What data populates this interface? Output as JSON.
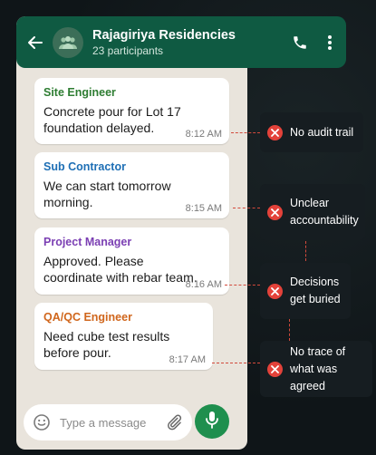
{
  "header": {
    "title": "Rajagiriya Residencies",
    "subtitle": "23 participants"
  },
  "messages": [
    {
      "sender": "Site Engineer",
      "sender_color": "#2e7d32",
      "text": "Concrete pour for Lot 17 foundation delayed.",
      "time": "8:12 AM"
    },
    {
      "sender": "Sub Contractor",
      "sender_color": "#1e6fb5",
      "text": "We can start tomorrow morning.",
      "time": "8:15 AM"
    },
    {
      "sender": "Project Manager",
      "sender_color": "#7b3fb3",
      "text": "Approved. Please coordinate with rebar team.",
      "time": "8:16 AM"
    },
    {
      "sender": "QA/QC Engineer",
      "sender_color": "#d0661c",
      "text": "Need cube test results before pour.",
      "time": "8:17 AM"
    }
  ],
  "input": {
    "placeholder": "Type a message"
  },
  "callouts": [
    {
      "text": "No audit trail"
    },
    {
      "text": "Unclear accountability"
    },
    {
      "text": "Decisions get buried"
    },
    {
      "text": "No trace of what was agreed"
    }
  ],
  "colors": {
    "header": "#0f5a42",
    "chat_bg": "#e9e4dc",
    "mic": "#1f8f4e",
    "warning": "#e3423a"
  },
  "icons": [
    "back-arrow-icon",
    "group-avatar-icon",
    "phone-icon",
    "more-vert-icon",
    "emoji-icon",
    "attach-icon",
    "mic-icon",
    "x-icon"
  ]
}
